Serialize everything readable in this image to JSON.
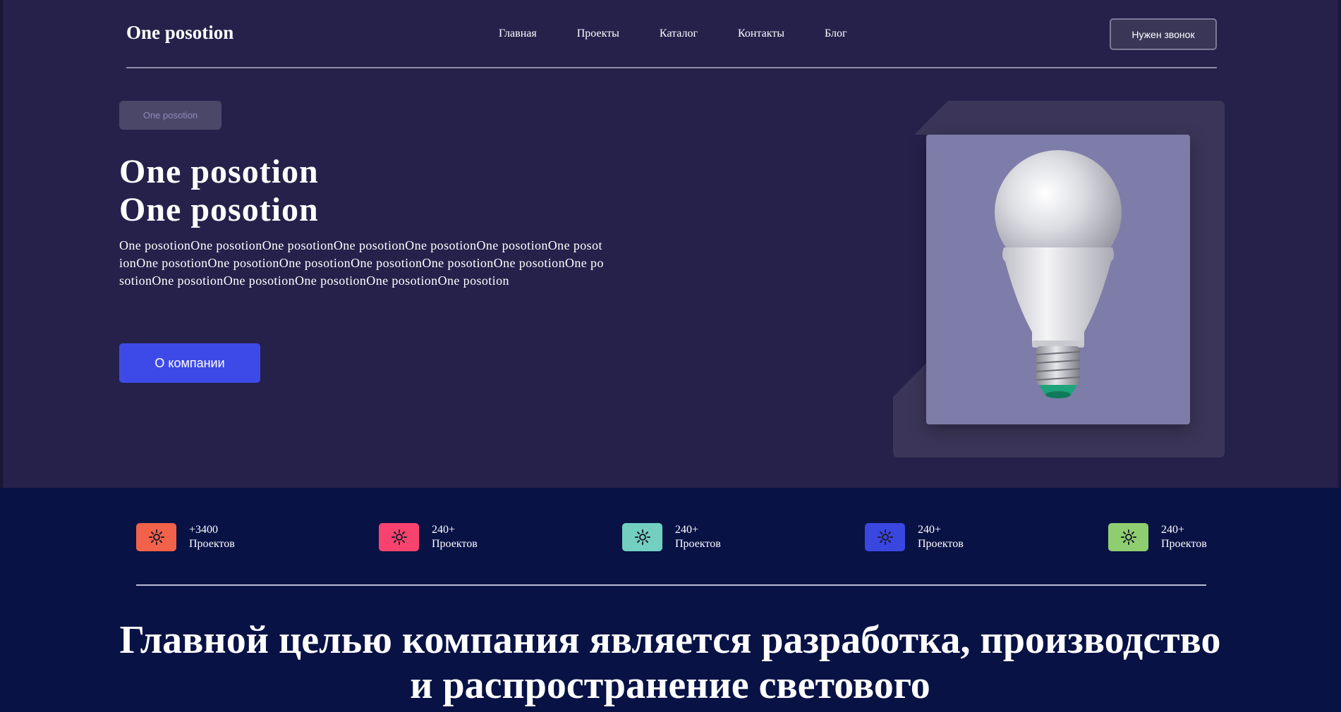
{
  "header": {
    "logo": "One posotion",
    "nav": [
      "Главная",
      "Проекты",
      "Каталог",
      "Контакты",
      "Блог"
    ],
    "call_button": "Нужен звонок"
  },
  "hero": {
    "badge": "One posotion",
    "title_line1": "One posotion",
    "title_line2": "One posotion",
    "text": "One posotionOne posotionOne posotionOne posotionOne posotionOne posotionOne posotionOne posotionOne posotionOne posotionOne posotionOne posotionOne posotionOne posotionOne posotionOne posotionOne posotionOne posotionOne posotion",
    "about_button": "О компании",
    "image_icon": "light-bulb-icon"
  },
  "stats": [
    {
      "value": "+3400",
      "label": "Проектов",
      "color": "#f26149",
      "icon": "sun-icon"
    },
    {
      "value": "240+",
      "label": "Проектов",
      "color": "#f7436e",
      "icon": "sun-icon"
    },
    {
      "value": "240+",
      "label": "Проектов",
      "color": "#73d0c0",
      "icon": "sun-icon"
    },
    {
      "value": "240+",
      "label": "Проектов",
      "color": "#3a46e0",
      "icon": "sun-icon"
    },
    {
      "value": "240+",
      "label": "Проектов",
      "color": "#8fce70",
      "icon": "sun-icon"
    }
  ],
  "mission": {
    "text": "Главной целью компания является разработка, производство и распространение светового"
  },
  "colors": {
    "hero_bg": "#26214b",
    "stats_bg": "#081245",
    "accent": "#3d4ae8",
    "image_card": "#7e7ca8"
  }
}
